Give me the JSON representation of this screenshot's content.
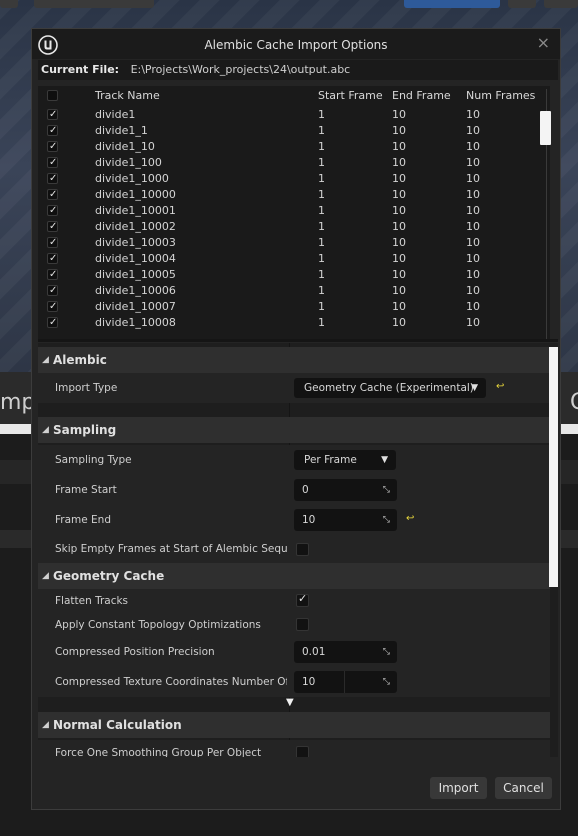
{
  "dialog": {
    "title": "Alembic Cache Import Options",
    "close_glyph": "×",
    "logo_icon": "unreal-engine-logo"
  },
  "current_file": {
    "label": "Current File:",
    "path": "E:\\Projects\\Work_projects\\24\\output.abc"
  },
  "background": {
    "left_text": "mp",
    "right_text": "C"
  },
  "tracks": {
    "columns": [
      "Track Name",
      "Start Frame",
      "End Frame",
      "Num Frames"
    ],
    "header_checked": false,
    "rows": [
      {
        "name": "divide1",
        "start": "1",
        "end": "10",
        "num": "10",
        "checked": true
      },
      {
        "name": "divide1_1",
        "start": "1",
        "end": "10",
        "num": "10",
        "checked": true
      },
      {
        "name": "divide1_10",
        "start": "1",
        "end": "10",
        "num": "10",
        "checked": true
      },
      {
        "name": "divide1_100",
        "start": "1",
        "end": "10",
        "num": "10",
        "checked": true
      },
      {
        "name": "divide1_1000",
        "start": "1",
        "end": "10",
        "num": "10",
        "checked": true
      },
      {
        "name": "divide1_10000",
        "start": "1",
        "end": "10",
        "num": "10",
        "checked": true
      },
      {
        "name": "divide1_10001",
        "start": "1",
        "end": "10",
        "num": "10",
        "checked": true
      },
      {
        "name": "divide1_10002",
        "start": "1",
        "end": "10",
        "num": "10",
        "checked": true
      },
      {
        "name": "divide1_10003",
        "start": "1",
        "end": "10",
        "num": "10",
        "checked": true
      },
      {
        "name": "divide1_10004",
        "start": "1",
        "end": "10",
        "num": "10",
        "checked": true
      },
      {
        "name": "divide1_10005",
        "start": "1",
        "end": "10",
        "num": "10",
        "checked": true
      },
      {
        "name": "divide1_10006",
        "start": "1",
        "end": "10",
        "num": "10",
        "checked": true
      },
      {
        "name": "divide1_10007",
        "start": "1",
        "end": "10",
        "num": "10",
        "checked": true
      },
      {
        "name": "divide1_10008",
        "start": "1",
        "end": "10",
        "num": "10",
        "checked": true
      }
    ]
  },
  "sections": {
    "alembic": {
      "title": "Alembic",
      "import_type_label": "Import Type",
      "import_type_value": "Geometry Cache (Experimental)"
    },
    "sampling": {
      "title": "Sampling",
      "sampling_type_label": "Sampling Type",
      "sampling_type_value": "Per Frame",
      "frame_start_label": "Frame Start",
      "frame_start_value": "0",
      "frame_end_label": "Frame End",
      "frame_end_value": "10",
      "skip_empty_label": "Skip Empty Frames at Start of Alembic Sequence",
      "skip_empty_checked": false
    },
    "geometry_cache": {
      "title": "Geometry Cache",
      "flatten_label": "Flatten Tracks",
      "flatten_checked": true,
      "topology_label": "Apply Constant Topology Optimizations",
      "topology_checked": false,
      "precision_label": "Compressed Position Precision",
      "precision_value": "0.01",
      "texcoord_label": "Compressed Texture Coordinates Number Of Bits",
      "texcoord_value": "10"
    },
    "normal_calculation": {
      "title": "Normal Calculation",
      "smoothing_label": "Force One Smoothing Group Per Object",
      "smoothing_checked": false
    }
  },
  "buttons": {
    "import": "Import",
    "cancel": "Cancel"
  },
  "colors": {
    "reset_arrow": "#e6d53c",
    "dialog_bg": "#242424"
  }
}
